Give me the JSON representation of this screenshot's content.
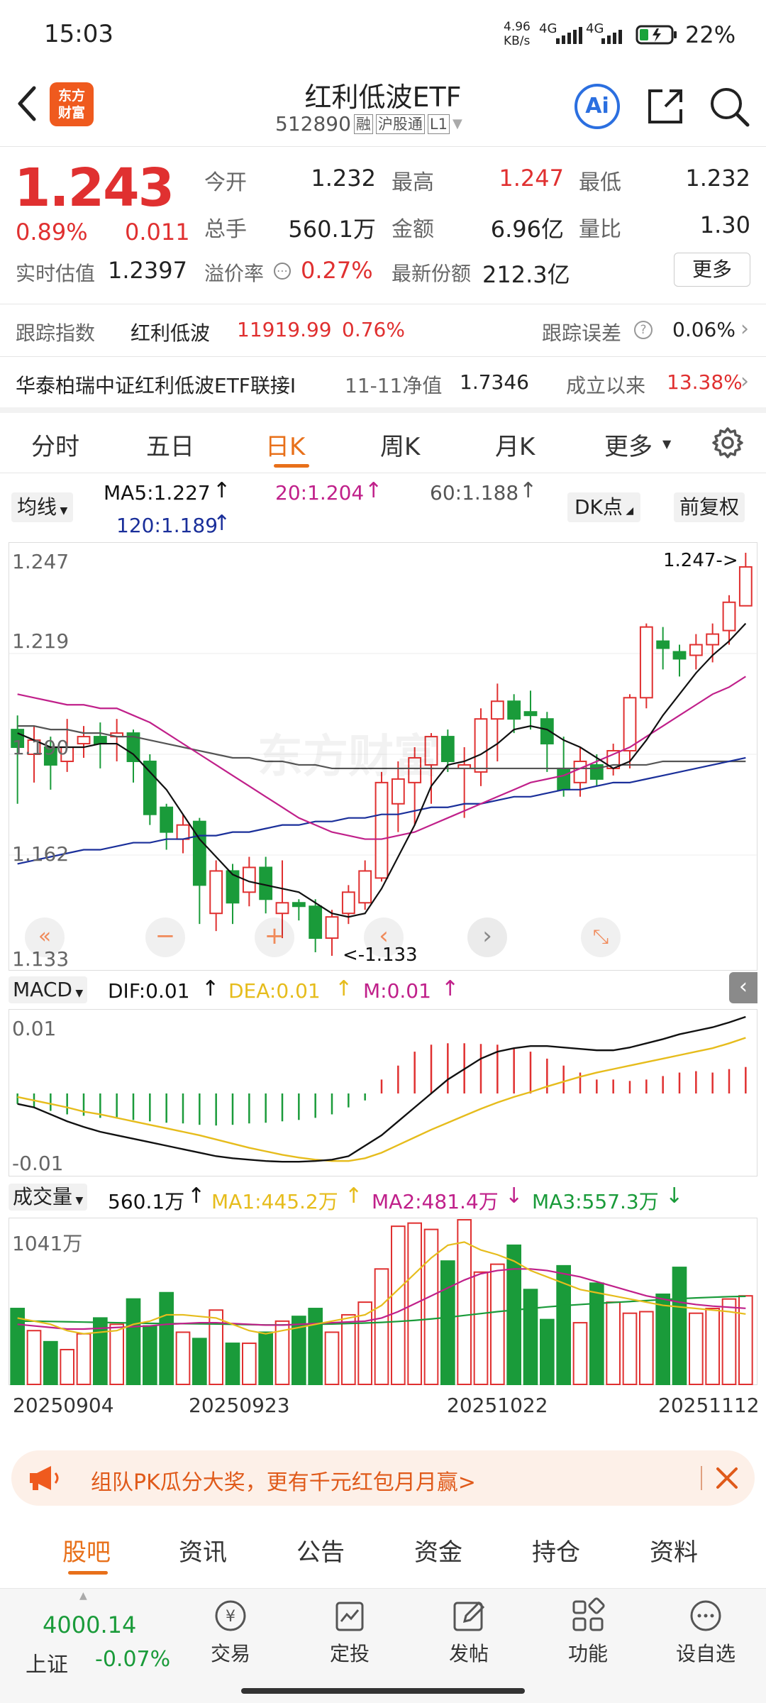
{
  "status": {
    "time": "15:03",
    "net_speed": "4.96",
    "net_unit": "KB/s",
    "sig1": "4G",
    "sig2": "4G",
    "battery": "22%"
  },
  "header": {
    "title": "红利低波ETF",
    "code": "512890",
    "tags": [
      "融",
      "沪股通",
      "L1"
    ],
    "logo_top": "东方",
    "logo_bottom": "财富",
    "ai": "Ai"
  },
  "quote": {
    "price": "1.243",
    "pct": "0.89%",
    "change": "0.011",
    "open_label": "今开",
    "open": "1.232",
    "high_label": "最高",
    "high": "1.247",
    "low_label": "最低",
    "low": "1.232",
    "vol_label": "总手",
    "vol": "560.1万",
    "amt_label": "金额",
    "amt": "6.96亿",
    "ratio_label": "量比",
    "ratio": "1.30",
    "iopv_label": "实时估值",
    "iopv": "1.2397",
    "prem_label": "溢价率",
    "prem": "0.27%",
    "share_label": "最新份额",
    "share": "212.3亿",
    "more": "更多"
  },
  "track": {
    "label": "跟踪指数",
    "index": "红利低波",
    "value": "11919.99",
    "pct": "0.76%",
    "err_label": "跟踪误差",
    "err": "0.06%"
  },
  "fund": {
    "name": "华泰柏瑞中证红利低波ETF联接I",
    "nav_label": "11-11净值",
    "nav": "1.7346",
    "since_label": "成立以来",
    "since": "13.38%"
  },
  "tabs": [
    "分时",
    "五日",
    "日K",
    "周K",
    "月K",
    "更多"
  ],
  "active_tab": 2,
  "ma": {
    "selector": "均线",
    "ma5": "MA5:1.227",
    "ma20": "20:1.204",
    "ma60": "60:1.188",
    "ma120": "120:1.189",
    "dk": "DK点",
    "fq": "前复权"
  },
  "price_axis": [
    "1.247",
    "1.219",
    "1.190",
    "1.162",
    "1.133"
  ],
  "hi_marker": "1.247->",
  "lo_marker": "<-1.133",
  "watermark": "东方财富",
  "macd": {
    "selector": "MACD",
    "dif": "DIF:0.01",
    "dea": "DEA:0.01",
    "m": "M:0.01",
    "axis_top": "0.01",
    "axis_bottom": "-0.01"
  },
  "volume": {
    "selector": "成交量",
    "value": "560.1万",
    "ma1": "MA1:445.2万",
    "ma2": "MA2:481.4万",
    "ma3": "MA3:557.3万",
    "axis_top": "1041万"
  },
  "dates": [
    "20250904",
    "20250923",
    "20251022",
    "20251112"
  ],
  "banner": {
    "text": "组队PK瓜分大奖，更有千元红包月月赢>"
  },
  "subtabs": [
    "股吧",
    "资讯",
    "公告",
    "资金",
    "持仓",
    "资料"
  ],
  "bottom": {
    "index_value": "4000.14",
    "index_name": "上证",
    "index_pct": "-0.07%",
    "items": [
      "交易",
      "定投",
      "发帖",
      "功能",
      "设自选"
    ]
  },
  "colors": {
    "up": "#e03030",
    "down": "#1a9b3a",
    "accent": "#e8701a",
    "ai_blue": "#2b6fe0",
    "ma5": "#111111",
    "ma20": "#c0208a",
    "ma60": "#555555",
    "ma120": "#1a2f9a",
    "dea": "#e6bc1c"
  },
  "chart_data": [
    {
      "type": "candlestick",
      "title": "日K",
      "ylim": [
        1.133,
        1.247
      ],
      "x_start": "20250904",
      "x_end": "20251112",
      "candles": [
        [
          1.197,
          1.192,
          1.201,
          1.176
        ],
        [
          1.19,
          1.194,
          1.198,
          1.182
        ],
        [
          1.192,
          1.187,
          1.195,
          1.18
        ],
        [
          1.188,
          1.192,
          1.2,
          1.185
        ],
        [
          1.193,
          1.195,
          1.198,
          1.189
        ],
        [
          1.195,
          1.193,
          1.199,
          1.186
        ],
        [
          1.195,
          1.196,
          1.2,
          1.188
        ],
        [
          1.196,
          1.188,
          1.197,
          1.182
        ],
        [
          1.188,
          1.173,
          1.19,
          1.17
        ],
        [
          1.175,
          1.168,
          1.176,
          1.163
        ],
        [
          1.166,
          1.17,
          1.173,
          1.162
        ],
        [
          1.171,
          1.153,
          1.172,
          1.142
        ],
        [
          1.145,
          1.157,
          1.16,
          1.14
        ],
        [
          1.157,
          1.148,
          1.159,
          1.142
        ],
        [
          1.151,
          1.158,
          1.161,
          1.147
        ],
        [
          1.158,
          1.149,
          1.161,
          1.145
        ],
        [
          1.145,
          1.148,
          1.16,
          1.138
        ],
        [
          1.148,
          1.147,
          1.149,
          1.143
        ],
        [
          1.147,
          1.138,
          1.149,
          1.134
        ],
        [
          1.138,
          1.144,
          1.146,
          1.133
        ],
        [
          1.145,
          1.151,
          1.153,
          1.142
        ],
        [
          1.148,
          1.157,
          1.16,
          1.146
        ],
        [
          1.155,
          1.182,
          1.185,
          1.154
        ],
        [
          1.176,
          1.183,
          1.188,
          1.168
        ],
        [
          1.182,
          1.189,
          1.192,
          1.17
        ],
        [
          1.187,
          1.195,
          1.196,
          1.176
        ],
        [
          1.195,
          1.188,
          1.197,
          1.185
        ],
        [
          1.186,
          1.187,
          1.192,
          1.172
        ],
        [
          1.185,
          1.2,
          1.203,
          1.181
        ],
        [
          1.2,
          1.205,
          1.21,
          1.188
        ],
        [
          1.205,
          1.2,
          1.207,
          1.196
        ],
        [
          1.202,
          1.201,
          1.208,
          1.197
        ],
        [
          1.2,
          1.193,
          1.202,
          1.185
        ],
        [
          1.186,
          1.18,
          1.195,
          1.178
        ],
        [
          1.182,
          1.188,
          1.192,
          1.178
        ],
        [
          1.187,
          1.183,
          1.19,
          1.181
        ],
        [
          1.186,
          1.191,
          1.193,
          1.184
        ],
        [
          1.191,
          1.206,
          1.207,
          1.186
        ],
        [
          1.206,
          1.226,
          1.227,
          1.203
        ],
        [
          1.222,
          1.22,
          1.226,
          1.214
        ],
        [
          1.219,
          1.217,
          1.221,
          1.212
        ],
        [
          1.218,
          1.221,
          1.224,
          1.214
        ],
        [
          1.221,
          1.224,
          1.227,
          1.216
        ],
        [
          1.225,
          1.233,
          1.235,
          1.221
        ],
        [
          1.232,
          1.243,
          1.247,
          1.232
        ]
      ],
      "ma5": [
        1.196,
        1.194,
        1.192,
        1.192,
        1.192,
        1.193,
        1.193,
        1.19,
        1.185,
        1.18,
        1.173,
        1.166,
        1.161,
        1.156,
        1.154,
        1.153,
        1.152,
        1.151,
        1.148,
        1.145,
        1.144,
        1.145,
        1.152,
        1.161,
        1.17,
        1.181,
        1.187,
        1.188,
        1.19,
        1.193,
        1.197,
        1.198,
        1.197,
        1.194,
        1.192,
        1.189,
        1.186,
        1.188,
        1.194,
        1.201,
        1.207,
        1.213,
        1.218,
        1.222,
        1.227
      ],
      "ma20": [
        1.207,
        1.206,
        1.205,
        1.204,
        1.204,
        1.203,
        1.203,
        1.201,
        1.199,
        1.196,
        1.193,
        1.19,
        1.187,
        1.184,
        1.181,
        1.178,
        1.175,
        1.172,
        1.17,
        1.168,
        1.167,
        1.166,
        1.166,
        1.167,
        1.168,
        1.17,
        1.172,
        1.174,
        1.176,
        1.178,
        1.18,
        1.182,
        1.183,
        1.184,
        1.186,
        1.188,
        1.19,
        1.192,
        1.195,
        1.198,
        1.201,
        1.204,
        1.207,
        1.209,
        1.212
      ],
      "ma60": [
        1.198,
        1.198,
        1.197,
        1.197,
        1.196,
        1.196,
        1.195,
        1.195,
        1.194,
        1.193,
        1.192,
        1.191,
        1.19,
        1.189,
        1.189,
        1.188,
        1.188,
        1.187,
        1.187,
        1.186,
        1.186,
        1.186,
        1.186,
        1.186,
        1.186,
        1.186,
        1.186,
        1.186,
        1.186,
        1.186,
        1.186,
        1.186,
        1.186,
        1.186,
        1.186,
        1.186,
        1.187,
        1.187,
        1.187,
        1.188,
        1.188,
        1.188,
        1.188,
        1.188,
        1.188
      ],
      "ma120": [
        1.159,
        1.16,
        1.161,
        1.162,
        1.163,
        1.163,
        1.164,
        1.165,
        1.165,
        1.166,
        1.166,
        1.167,
        1.167,
        1.168,
        1.168,
        1.169,
        1.17,
        1.17,
        1.171,
        1.171,
        1.172,
        1.172,
        1.173,
        1.173,
        1.174,
        1.175,
        1.175,
        1.176,
        1.176,
        1.177,
        1.178,
        1.178,
        1.179,
        1.18,
        1.18,
        1.181,
        1.182,
        1.182,
        1.183,
        1.184,
        1.185,
        1.186,
        1.187,
        1.188,
        1.189
      ]
    },
    {
      "type": "bar",
      "title": "MACD",
      "ylim": [
        -0.011,
        0.011
      ],
      "macd_bars": [
        -0.0015,
        -0.002,
        -0.0025,
        -0.003,
        -0.0032,
        -0.0035,
        -0.0036,
        -0.0038,
        -0.004,
        -0.0042,
        -0.0043,
        -0.0045,
        -0.0046,
        -0.0045,
        -0.0043,
        -0.0042,
        -0.004,
        -0.0038,
        -0.0035,
        -0.003,
        -0.002,
        -0.001,
        0.002,
        0.004,
        0.006,
        0.007,
        0.0072,
        0.0072,
        0.0071,
        0.007,
        0.0065,
        0.006,
        0.005,
        0.004,
        0.003,
        0.002,
        0.002,
        0.0018,
        0.002,
        0.0025,
        0.003,
        0.0032,
        0.003,
        0.0035,
        0.0038
      ],
      "dif": [
        -0.0015,
        -0.002,
        -0.003,
        -0.004,
        -0.0048,
        -0.0055,
        -0.006,
        -0.0065,
        -0.007,
        -0.0075,
        -0.008,
        -0.0085,
        -0.009,
        -0.0093,
        -0.0095,
        -0.0097,
        -0.0098,
        -0.0098,
        -0.0097,
        -0.0095,
        -0.009,
        -0.0075,
        -0.006,
        -0.004,
        -0.002,
        0.0,
        0.002,
        0.0035,
        0.005,
        0.006,
        0.0065,
        0.0068,
        0.0068,
        0.0066,
        0.0064,
        0.0062,
        0.0062,
        0.0066,
        0.0072,
        0.0078,
        0.0085,
        0.009,
        0.0095,
        0.0102,
        0.011
      ],
      "dea": [
        -0.0005,
        -0.001,
        -0.0015,
        -0.002,
        -0.0026,
        -0.003,
        -0.0035,
        -0.004,
        -0.0045,
        -0.005,
        -0.0055,
        -0.006,
        -0.0066,
        -0.0072,
        -0.0078,
        -0.0083,
        -0.0088,
        -0.0092,
        -0.0095,
        -0.0097,
        -0.0097,
        -0.0093,
        -0.0085,
        -0.0074,
        -0.0063,
        -0.0052,
        -0.0042,
        -0.0032,
        -0.0022,
        -0.0013,
        -0.0005,
        0.0002,
        0.001,
        0.0017,
        0.0024,
        0.003,
        0.0035,
        0.004,
        0.0045,
        0.005,
        0.0055,
        0.006,
        0.0065,
        0.0072,
        0.008
      ]
    },
    {
      "type": "bar",
      "title": "成交量",
      "ylim": [
        0,
        1041
      ],
      "volumes": [
        480,
        340,
        270,
        220,
        320,
        420,
        380,
        540,
        370,
        580,
        330,
        290,
        470,
        260,
        260,
        330,
        400,
        430,
        480,
        330,
        440,
        520,
        730,
        1000,
        1020,
        980,
        780,
        1041,
        710,
        760,
        880,
        600,
        410,
        750,
        390,
        640,
        520,
        450,
        460,
        570,
        740,
        450,
        480,
        540,
        560
      ],
      "ma1": [
        420,
        400,
        380,
        340,
        320,
        330,
        340,
        380,
        400,
        440,
        440,
        430,
        420,
        380,
        340,
        320,
        340,
        360,
        380,
        400,
        420,
        440,
        500,
        600,
        700,
        800,
        880,
        900,
        850,
        820,
        780,
        720,
        680,
        640,
        600,
        580,
        560,
        540,
        520,
        500,
        490,
        480,
        470,
        460,
        445
      ],
      "ma2": [
        380,
        370,
        360,
        350,
        350,
        355,
        360,
        365,
        370,
        380,
        385,
        390,
        390,
        385,
        380,
        375,
        375,
        380,
        385,
        390,
        395,
        400,
        420,
        460,
        510,
        560,
        610,
        660,
        700,
        720,
        730,
        730,
        720,
        700,
        680,
        650,
        620,
        590,
        560,
        540,
        520,
        505,
        495,
        488,
        481
      ],
      "ma3": [
        400,
        400,
        398,
        396,
        394,
        392,
        390,
        388,
        386,
        385,
        384,
        383,
        382,
        380,
        378,
        376,
        376,
        378,
        380,
        382,
        385,
        388,
        392,
        398,
        405,
        414,
        424,
        436,
        448,
        460,
        470,
        480,
        490,
        498,
        505,
        512,
        518,
        524,
        530,
        536,
        542,
        547,
        551,
        555,
        557
      ]
    }
  ]
}
